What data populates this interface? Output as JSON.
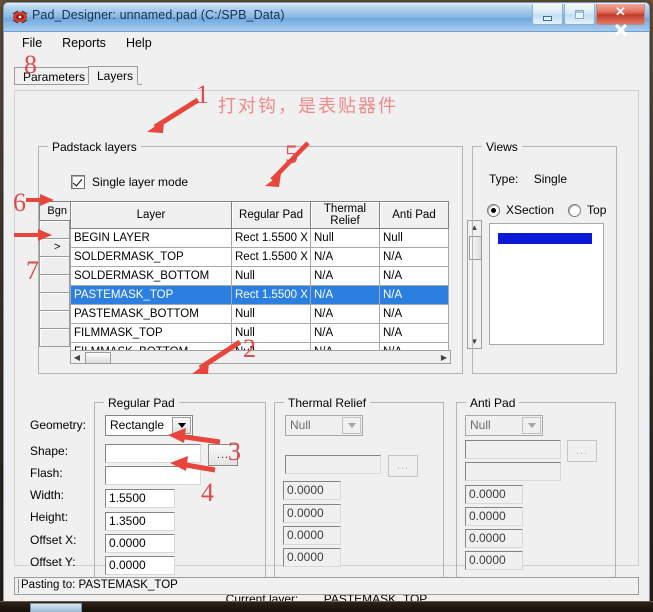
{
  "window": {
    "title": "Pad_Designer: unnamed.pad (C:/SPB_Data)",
    "icon_name": "pad-designer-app-icon",
    "minimize_glyph": "",
    "maximize_glyph": "",
    "close_glyph": "✕"
  },
  "menubar": {
    "items": [
      {
        "label": "File"
      },
      {
        "label": "Reports"
      },
      {
        "label": "Help"
      }
    ]
  },
  "tabs": [
    {
      "label": "Parameters",
      "active": false
    },
    {
      "label": "Layers",
      "active": true
    }
  ],
  "padstack": {
    "legend": "Padstack layers",
    "single_layer_mode": {
      "label": "Single layer mode",
      "checked": true
    },
    "bgn_header": "Bgn",
    "columns": [
      "Layer",
      "Regular Pad",
      "Thermal Relief",
      "Anti Pad"
    ],
    "rows": [
      {
        "bgn": ">",
        "layer": "BEGIN LAYER",
        "regular": "Rect 1.5500 X",
        "thermal": "Null",
        "anti": "Null",
        "selected": false,
        "bgn_marker": ""
      },
      {
        "bgn": ">",
        "layer": "SOLDERMASK_TOP",
        "regular": "Rect 1.5500 X",
        "thermal": "N/A",
        "anti": "N/A",
        "selected": false,
        "bgn_marker": ">"
      },
      {
        "bgn": "",
        "layer": "SOLDERMASK_BOTTOM",
        "regular": "Null",
        "thermal": "N/A",
        "anti": "N/A",
        "selected": false,
        "bgn_marker": ""
      },
      {
        "bgn": "",
        "layer": "PASTEMASK_TOP",
        "regular": "Rect 1.5500 X",
        "thermal": "N/A",
        "anti": "N/A",
        "selected": true,
        "bgn_marker": ""
      },
      {
        "bgn": "",
        "layer": "PASTEMASK_BOTTOM",
        "regular": "Null",
        "thermal": "N/A",
        "anti": "N/A",
        "selected": false,
        "bgn_marker": ""
      },
      {
        "bgn": "",
        "layer": "FILMMASK_TOP",
        "regular": "Null",
        "thermal": "N/A",
        "anti": "N/A",
        "selected": false,
        "bgn_marker": ""
      },
      {
        "bgn": "",
        "layer": "FILMMASK_BOTTOM",
        "regular": "Null",
        "thermal": "N/A",
        "anti": "N/A",
        "selected": false,
        "bgn_marker": ""
      }
    ],
    "scroll_up_glyph": "▲",
    "scroll_down_glyph": "▼",
    "scroll_left_glyph": "◀",
    "scroll_right_glyph": "▶"
  },
  "views": {
    "legend": "Views",
    "type_label": "Type:",
    "type_value": "Single",
    "radios": [
      {
        "label": "XSection",
        "selected": true
      },
      {
        "label": "Top",
        "selected": false
      }
    ],
    "preview_bar_color": "#0b18d6"
  },
  "regular_pad": {
    "legend": "Regular Pad",
    "labels": {
      "geometry": "Geometry:",
      "shape": "Shape:",
      "flash": "Flash:",
      "width": "Width:",
      "height": "Height:",
      "offset_x": "Offset X:",
      "offset_y": "Offset Y:"
    },
    "geometry": "Rectangle",
    "shape": "",
    "flash": "",
    "width": "1.5500",
    "height": "1.3500",
    "offset_x": "0.0000",
    "offset_y": "0.0000",
    "browse_label": "..."
  },
  "thermal_relief": {
    "legend": "Thermal Relief",
    "geometry": "Null",
    "shape": "",
    "width": "0.0000",
    "height": "0.0000",
    "offset_x": "0.0000",
    "offset_y": "0.0000",
    "browse_label": "..."
  },
  "anti_pad": {
    "legend": "Anti Pad",
    "geometry": "Null",
    "shape": "",
    "flash": "",
    "width": "0.0000",
    "height": "0.0000",
    "offset_x": "0.0000",
    "offset_y": "0.0000",
    "browse_label": "..."
  },
  "current_layer": {
    "label": "Current layer:",
    "value": "PASTEMASK_TOP"
  },
  "statusbar": {
    "text": "Pasting to: PASTEMASK_TOP"
  },
  "annotations": {
    "chinese_note": "打对钩，是表贴器件",
    "numbers": [
      {
        "id": "n1",
        "text": "1"
      },
      {
        "id": "n2",
        "text": "2"
      },
      {
        "id": "n3",
        "text": "3"
      },
      {
        "id": "n4",
        "text": "4"
      },
      {
        "id": "n5",
        "text": "5"
      },
      {
        "id": "n6",
        "text": "6"
      },
      {
        "id": "n7",
        "text": "7"
      },
      {
        "id": "n8",
        "text": "8"
      }
    ],
    "color": "#e04a4a"
  }
}
